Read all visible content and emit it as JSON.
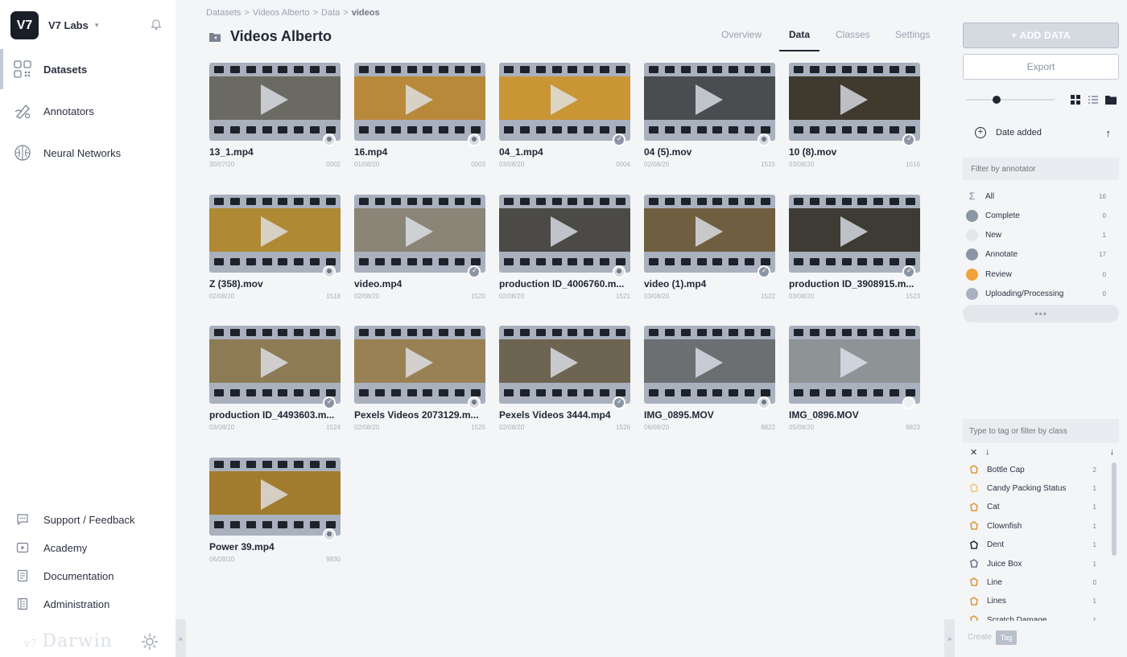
{
  "app": {
    "logo_text": "V7",
    "team_name": "V7 Labs",
    "brand_small": "v7",
    "brand": "Darwin"
  },
  "sidebar": {
    "items": [
      {
        "label": "Datasets",
        "icon": "datasets-icon",
        "active": true
      },
      {
        "label": "Annotators",
        "icon": "annotators-icon",
        "active": false
      },
      {
        "label": "Neural Networks",
        "icon": "neural-networks-icon",
        "active": false
      }
    ],
    "footer": [
      {
        "label": "Support / Feedback",
        "icon": "chat-icon"
      },
      {
        "label": "Academy",
        "icon": "play-icon"
      },
      {
        "label": "Documentation",
        "icon": "document-icon"
      },
      {
        "label": "Administration",
        "icon": "administration-icon"
      }
    ]
  },
  "breadcrumb": [
    {
      "label": "Datasets",
      "sep": ">"
    },
    {
      "label": "Videos Alberto",
      "sep": ">"
    },
    {
      "label": "Data",
      "sep": ">"
    },
    {
      "label": "videos",
      "sep": ""
    }
  ],
  "page": {
    "title": "Videos Alberto"
  },
  "tabs": [
    {
      "label": "Overview",
      "active": false
    },
    {
      "label": "Data",
      "active": true
    },
    {
      "label": "Classes",
      "active": false
    },
    {
      "label": "Settings",
      "active": false
    }
  ],
  "files": [
    {
      "name": "13_1.mp4",
      "date": "30/07/20",
      "id": "0002",
      "status": "avatar",
      "tint": "#6b6a62"
    },
    {
      "name": "16.mp4",
      "date": "01/08/20",
      "id": "0003",
      "status": "avatar",
      "tint": "#b8893a"
    },
    {
      "name": "04_1.mp4",
      "date": "03/08/20",
      "id": "0004",
      "status": "check",
      "tint": "#c99535"
    },
    {
      "name": "04 (5).mov",
      "date": "02/08/20",
      "id": "1515",
      "status": "avatar",
      "tint": "#4a4d50"
    },
    {
      "name": "10 (8).mov",
      "date": "03/08/20",
      "id": "1516",
      "status": "check",
      "tint": "#3f3a2e"
    },
    {
      "name": "Z (358).mov",
      "date": "02/08/20",
      "id": "1518",
      "status": "avatar",
      "tint": "#b08934"
    },
    {
      "name": "video.mp4",
      "date": "02/08/20",
      "id": "1520",
      "status": "check",
      "tint": "#8a8576"
    },
    {
      "name": "production ID_4006760.m...",
      "date": "02/08/20",
      "id": "1521",
      "status": "avatar",
      "tint": "#4b4a47"
    },
    {
      "name": "video (1).mp4",
      "date": "03/08/20",
      "id": "1522",
      "status": "check",
      "tint": "#6f5f40"
    },
    {
      "name": "production ID_3908915.m...",
      "date": "03/08/20",
      "id": "1523",
      "status": "check",
      "tint": "#3e3b34"
    },
    {
      "name": "production ID_4493603.m...",
      "date": "03/08/20",
      "id": "1524",
      "status": "check",
      "tint": "#8c7b55"
    },
    {
      "name": "Pexels Videos 2073129.m...",
      "date": "02/08/20",
      "id": "1525",
      "status": "avatar",
      "tint": "#9a8153"
    },
    {
      "name": "Pexels Videos 3444.mp4",
      "date": "02/08/20",
      "id": "1526",
      "status": "check",
      "tint": "#6e6452"
    },
    {
      "name": "IMG_0895.MOV",
      "date": "06/08/20",
      "id": "8822",
      "status": "avatar",
      "tint": "#6b6f72"
    },
    {
      "name": "IMG_0896.MOV",
      "date": "05/08/20",
      "id": "8823",
      "status": "blank",
      "tint": "#8e9396"
    },
    {
      "name": "Power 39.mp4",
      "date": "06/08/20",
      "id": "9930",
      "status": "avatar",
      "tint": "#a27c2e"
    }
  ],
  "actions": {
    "add_data": "+ ADD DATA",
    "export": "Export"
  },
  "sort": {
    "label": "Date added",
    "direction": "↑"
  },
  "annotator_filter": {
    "placeholder": "Filter by annotator"
  },
  "statuses": [
    {
      "label": "All",
      "count": "16",
      "icon": "sigma-icon",
      "color": "#7a8393"
    },
    {
      "label": "Complete",
      "count": "0",
      "icon": "complete-icon",
      "color": "#8c95a3"
    },
    {
      "label": "New",
      "count": "1",
      "icon": "new-icon",
      "color": "#e3e7ec"
    },
    {
      "label": "Annotate",
      "count": "17",
      "icon": "annotate-icon",
      "color": "#8c95a3"
    },
    {
      "label": "Review",
      "count": "0",
      "icon": "review-icon",
      "color": "#f0a33a"
    },
    {
      "label": "Uploading/Processing",
      "count": "0",
      "icon": "uploading-icon",
      "color": "#a9b1bf"
    }
  ],
  "more_label": "•••",
  "tag_filter": {
    "placeholder": "Type to tag or filter by class"
  },
  "classes": [
    {
      "label": "Bottle Cap",
      "count": "2",
      "icon": "polygon-icon",
      "color": "#d99a3c"
    },
    {
      "label": "Candy Packing Status",
      "count": "1",
      "icon": "tag-icon",
      "color": "#f0c877"
    },
    {
      "label": "Cat",
      "count": "1",
      "icon": "polygon-icon",
      "color": "#d99a3c"
    },
    {
      "label": "Clownfish",
      "count": "1",
      "icon": "polygon-icon",
      "color": "#d99a3c"
    },
    {
      "label": "Dent",
      "count": "1",
      "icon": "polygon-icon",
      "color": "#2b3140"
    },
    {
      "label": "Juice Box",
      "count": "1",
      "icon": "polygon-icon",
      "color": "#6f7888"
    },
    {
      "label": "Line",
      "count": "0",
      "icon": "line-icon",
      "color": "#d99a3c"
    },
    {
      "label": "Lines",
      "count": "1",
      "icon": "polygon-icon",
      "color": "#d99a3c"
    },
    {
      "label": "Scratch Damage",
      "count": "1",
      "icon": "polygon-icon",
      "color": "#d99a3c"
    }
  ],
  "create": {
    "label": "Create",
    "chip": "Tag"
  }
}
